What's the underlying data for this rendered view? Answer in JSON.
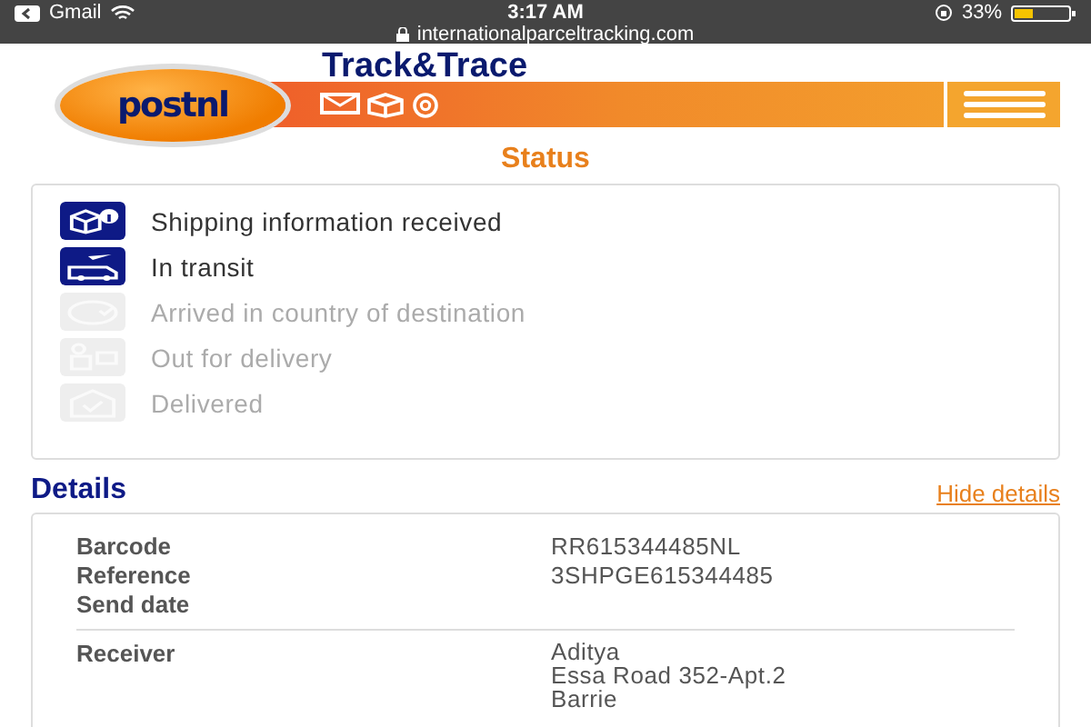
{
  "status_bar": {
    "back_app": "Gmail",
    "time": "3:17 AM",
    "battery": "33%",
    "url": "internationalparceltracking.com"
  },
  "header": {
    "title": "Track&Trace",
    "logo_text": "postnl"
  },
  "status": {
    "title": "Status",
    "steps": [
      {
        "kind": "info",
        "label": "Shipping information received",
        "completed": true
      },
      {
        "kind": "transit",
        "label": "In transit",
        "completed": true
      },
      {
        "kind": "arrived",
        "label": "Arrived in country of destination",
        "completed": false
      },
      {
        "kind": "out",
        "label": "Out for delivery",
        "completed": false
      },
      {
        "kind": "delivered",
        "label": "Delivered",
        "completed": false
      }
    ]
  },
  "details": {
    "title": "Details",
    "toggle_link": "Hide details",
    "fields": [
      {
        "label": "Barcode",
        "value": "RR615344485NL"
      },
      {
        "label": "Reference",
        "value": "3SHPGE615344485"
      },
      {
        "label": "Send date"
      }
    ],
    "receiver": {
      "label": "Receiver",
      "lines": [
        "Aditya",
        "Essa Road 352-Apt.2",
        "Barrie"
      ]
    }
  }
}
